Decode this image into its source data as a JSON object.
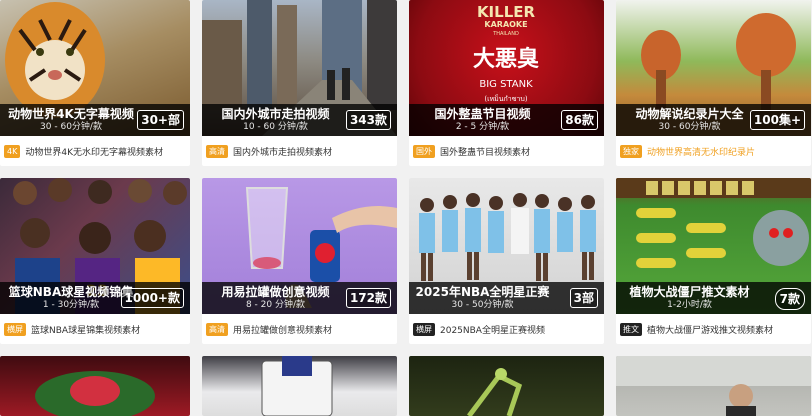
{
  "cards": [
    {
      "title": "动物世界4K无字幕视频",
      "subtitle": "30 - 60分钟/款",
      "count": "30+部",
      "tag": "4K",
      "tag_color": "#f0a020",
      "meta": "动物世界4K无水印无字幕视频素材"
    },
    {
      "title": "国内外城市走拍视频",
      "subtitle": "10 - 60 分钟/款",
      "count": "343款",
      "tag": "高清",
      "tag_color": "#f0a020",
      "meta": "国内外城市走拍视频素材"
    },
    {
      "title": "国外整蛊节目视频",
      "subtitle": "2 - 5 分钟/款",
      "count": "86款",
      "tag": "国外",
      "tag_color": "#f0a020",
      "meta": "国外整蛊节目视频素材",
      "thumb_text_1": "KILLER",
      "thumb_text_2": "KARAOKE",
      "thumb_text_3": "THAILAND",
      "thumb_text_4": "大悪臭",
      "thumb_text_5": "BIG STANK",
      "thumb_text_6": "(เหม็นกำซาบ)"
    },
    {
      "title": "动物解说纪录片大全",
      "subtitle": "30 - 60分钟/款",
      "count": "100集+",
      "tag": "独家",
      "tag_color": "#f0a020",
      "meta": "动物世界高清无水印纪录片",
      "meta_color": "#f0a020"
    },
    {
      "title": "篮球NBA球星视频锦集",
      "subtitle": "1 - 30分钟/款",
      "count": "1000+款",
      "tag": "横屏",
      "tag_color": "#f0a020",
      "meta": "篮球NBA球星锦集视频素材"
    },
    {
      "title": "用易拉罐做创意视频",
      "subtitle": "8 - 20 分钟/款",
      "count": "172款",
      "tag": "高清",
      "tag_color": "#f0a020",
      "meta": "用易拉罐做创意视频素材"
    },
    {
      "title": "2025年NBA全明星正赛",
      "subtitle": "30 - 50分钟/款",
      "count": "3部",
      "tag": "横屏",
      "tag_color": "#222222",
      "meta": "2025NBA全明星正赛视频"
    },
    {
      "title": "植物大战僵尸推文素材",
      "subtitle": "1-2小时/款",
      "count": "7款",
      "tag": "推文",
      "tag_color": "#222222",
      "meta": "植物大战僵尸游戏推文视频素材"
    }
  ]
}
